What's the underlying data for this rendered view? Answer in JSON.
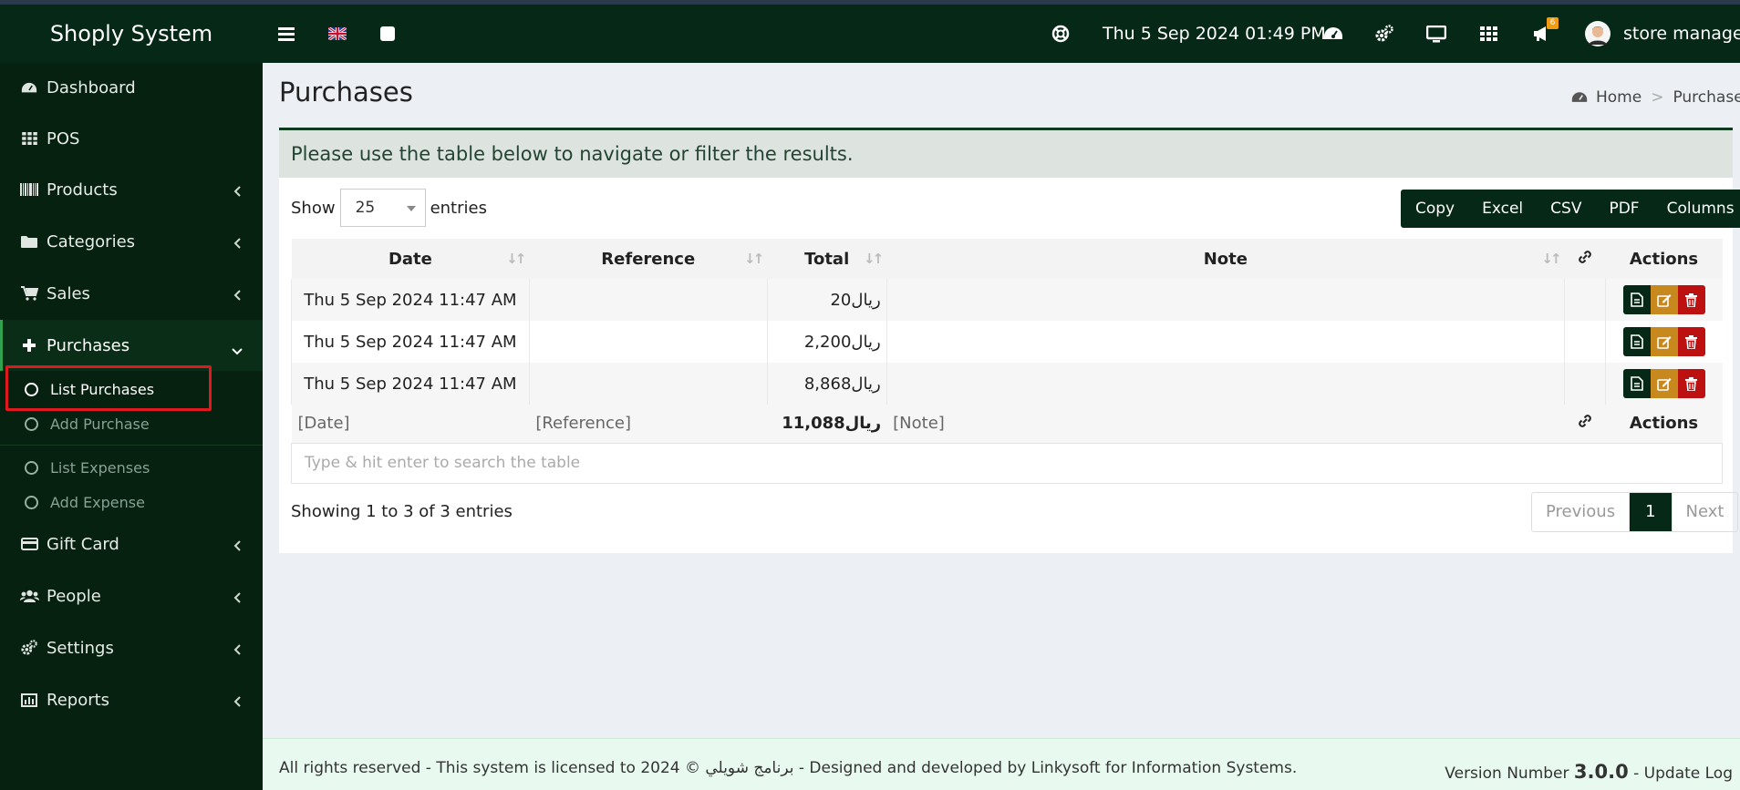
{
  "app": {
    "title": "Shoply System"
  },
  "topbar": {
    "datetime": "Thu 5 Sep 2024 01:49 PM",
    "notifications_count": "6",
    "user_name": "store manager",
    "icons": [
      "menu-icon",
      "flag-uk-icon",
      "square-icon",
      "help-icon",
      "dashboard-icon",
      "settings-icon",
      "monitor-icon",
      "grid-icon",
      "megaphone-icon",
      "avatar"
    ]
  },
  "sidebar": {
    "items": [
      {
        "label": "Dashboard",
        "icon": "dashboard-icon"
      },
      {
        "label": "POS",
        "icon": "grid-icon"
      },
      {
        "label": "Products",
        "icon": "barcode-icon"
      },
      {
        "label": "Categories",
        "icon": "folder-icon"
      },
      {
        "label": "Sales",
        "icon": "cart-icon"
      },
      {
        "label": "Purchases",
        "icon": "plus-icon"
      },
      {
        "label": "Gift Card",
        "icon": "credit-card-icon"
      },
      {
        "label": "People",
        "icon": "users-icon"
      },
      {
        "label": "Settings",
        "icon": "cogs-icon"
      },
      {
        "label": "Reports",
        "icon": "bar-chart-icon"
      }
    ],
    "purchases_sub": [
      "List Purchases",
      "Add Purchase",
      "List Expenses",
      "Add Expense"
    ]
  },
  "page": {
    "title": "Purchases",
    "breadcrumb": {
      "home": "Home",
      "separator": ">",
      "current": "Purchases"
    },
    "notice": "Please use the table below to navigate or filter the results."
  },
  "table_controls": {
    "show_label": "Show",
    "entries_value": "25",
    "entries_label": "entries",
    "export_buttons": [
      "Copy",
      "Excel",
      "CSV",
      "PDF",
      "Columns"
    ]
  },
  "table": {
    "columns": [
      "Date",
      "Reference",
      "Total",
      "Note",
      "Actions"
    ],
    "rows": [
      {
        "date": "Thu 5 Sep 2024 11:47 AM",
        "reference": "",
        "total": "ريال20",
        "note": ""
      },
      {
        "date": "Thu 5 Sep 2024 11:47 AM",
        "reference": "",
        "total": "ريال2,200",
        "note": ""
      },
      {
        "date": "Thu 5 Sep 2024 11:47 AM",
        "reference": "",
        "total": "ريال8,868",
        "note": ""
      }
    ],
    "footer": {
      "date": "[Date]",
      "reference": "[Reference]",
      "total": "ريال11,088",
      "note": "[Note]",
      "actions": "Actions"
    },
    "search_placeholder": "Type & hit enter to search the table"
  },
  "pagination": {
    "info": "Showing 1 to 3 of 3 entries",
    "previous": "Previous",
    "current": "1",
    "next": "Next"
  },
  "footer": {
    "copyright": "All rights reserved - This system is licensed to 2024 © برنامج شويلي - Designed and developed by Linkysoft for Information Systems.",
    "version_label": "Version Number",
    "version": "3.0.0",
    "update_log": "- Update Log"
  },
  "colors": {
    "brand_dark": "#062816",
    "edit": "#c7881e",
    "delete": "#bd1010",
    "highlight": "#e0191f"
  }
}
